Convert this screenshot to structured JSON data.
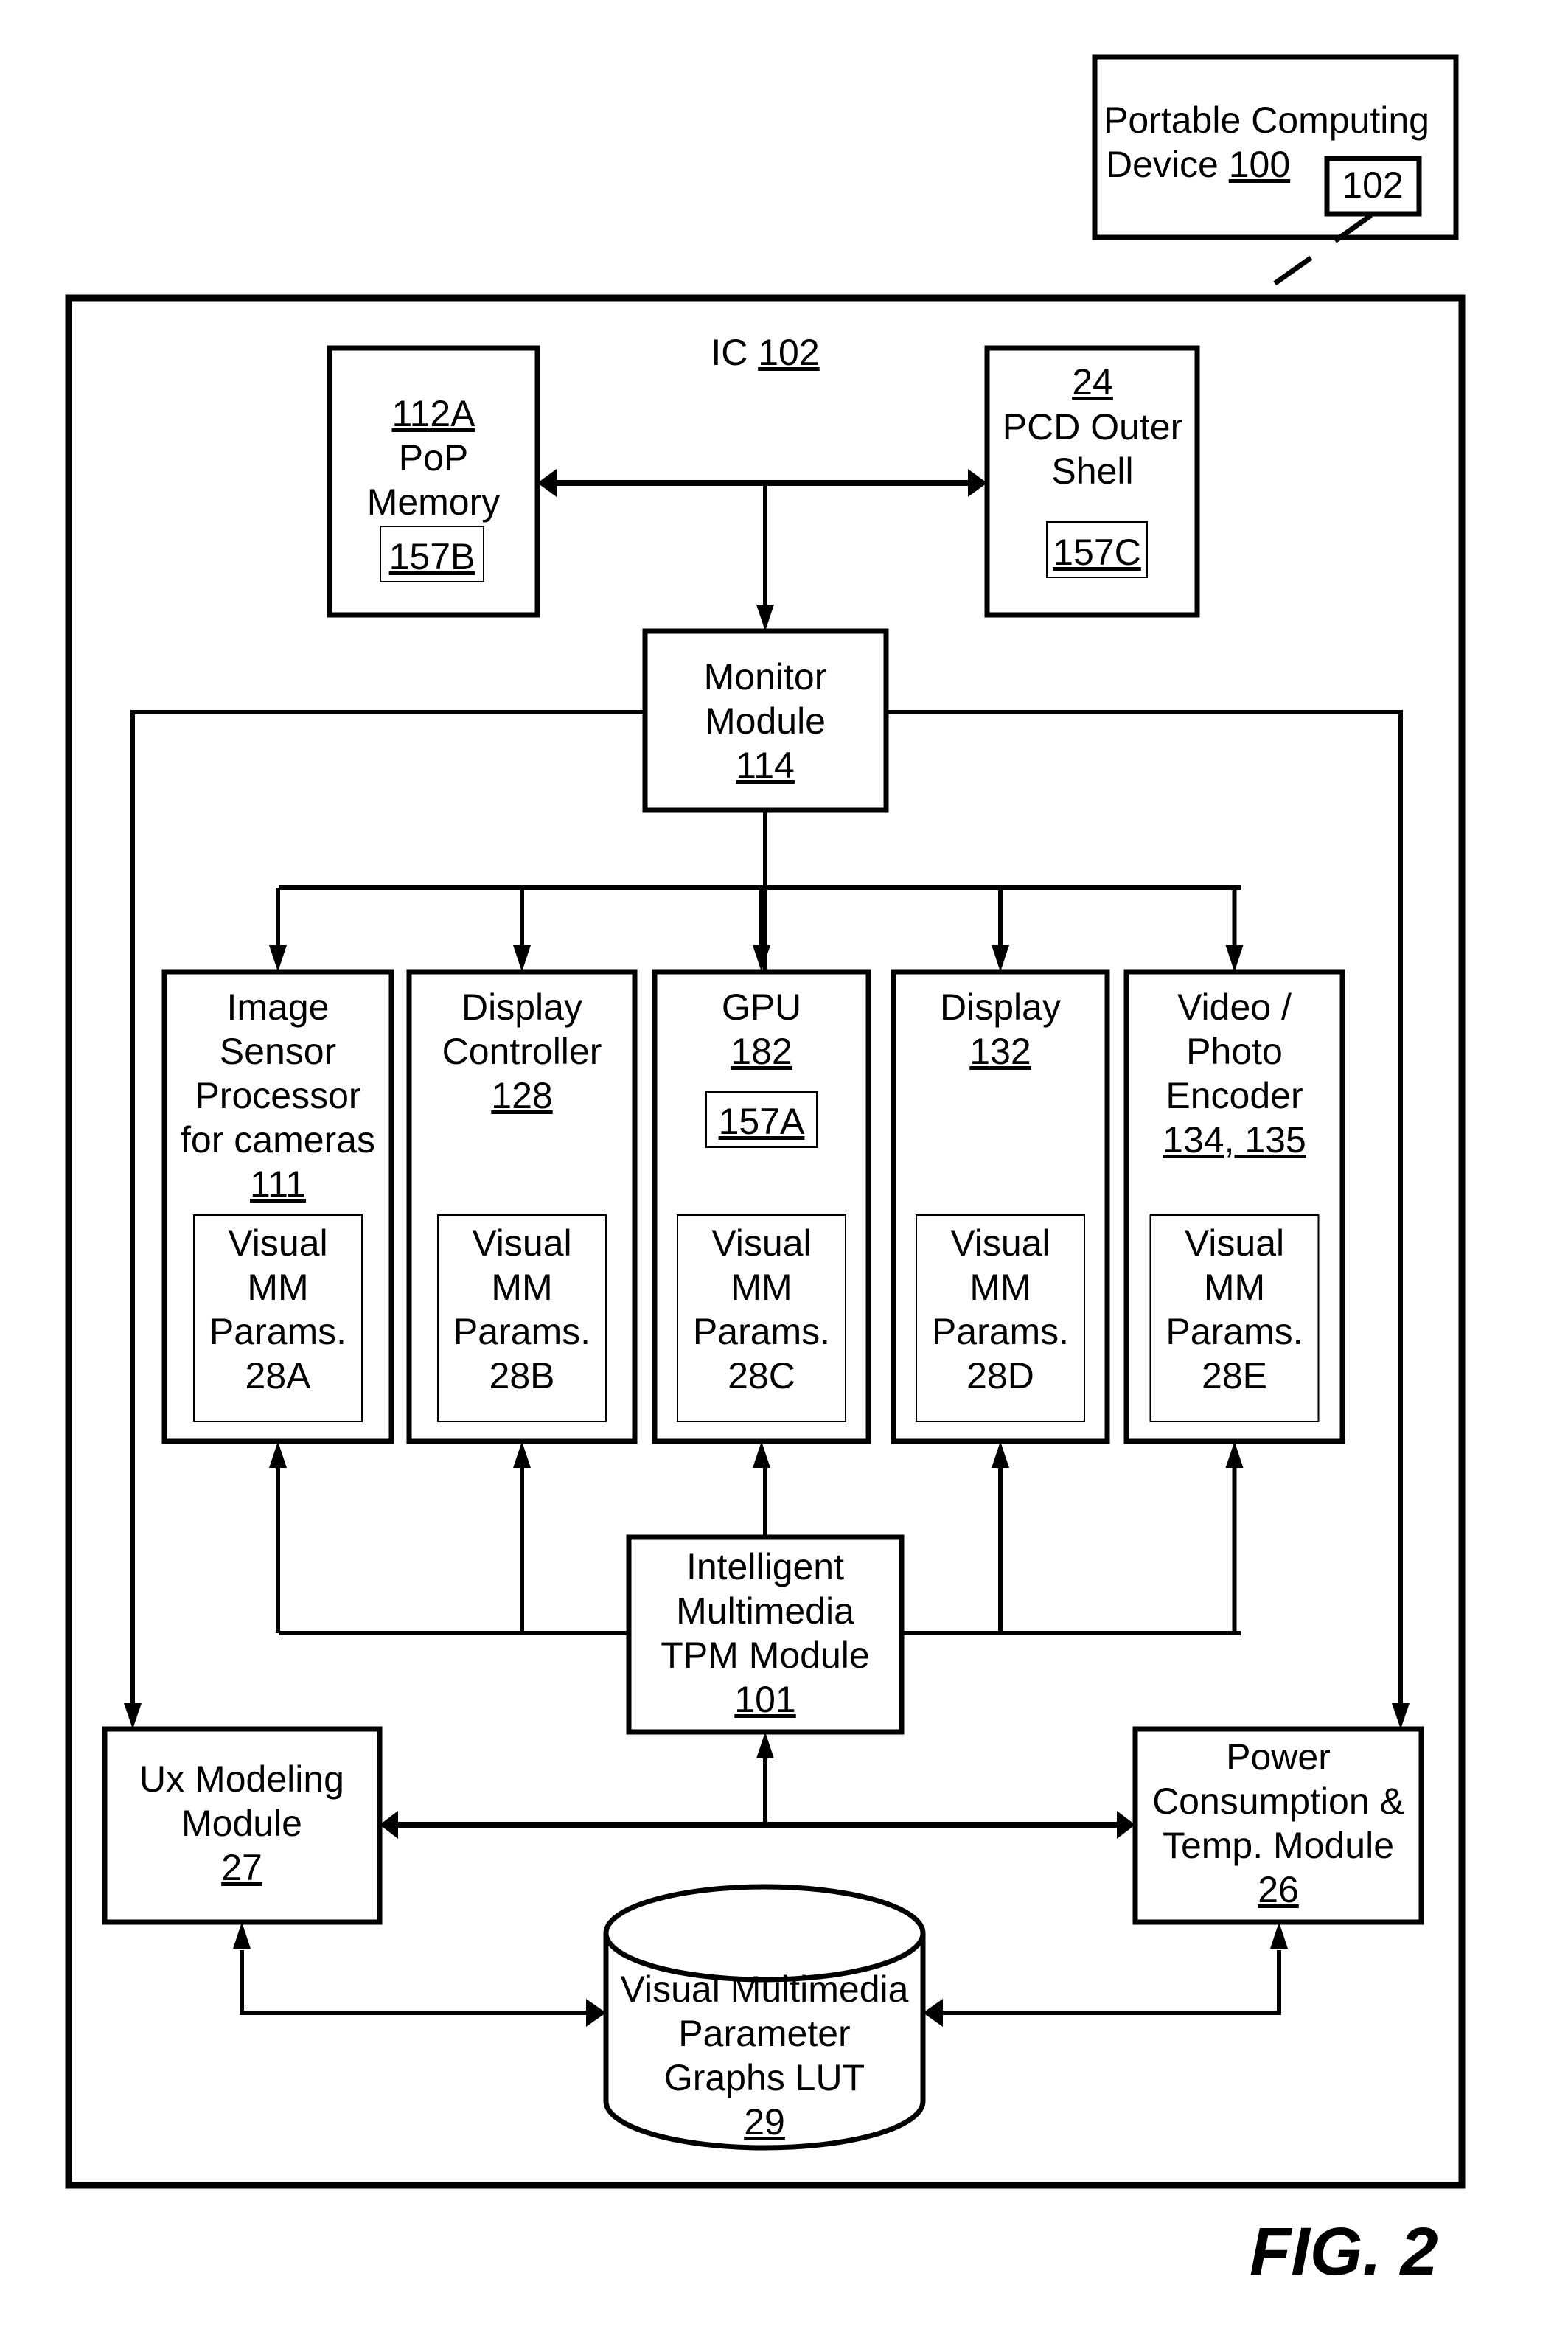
{
  "figure_label": "FIG. 2",
  "pcd": {
    "line1": "Portable Computing",
    "line2_prefix": "Device ",
    "ref": "100",
    "inner_ref": "102"
  },
  "ic": {
    "label_prefix": "IC ",
    "ref": "102"
  },
  "pop_memory": {
    "ref": "112A",
    "line1": "PoP",
    "line2": "Memory",
    "sensor_ref": "157B"
  },
  "outer_shell": {
    "ref": "24",
    "line1": "PCD Outer",
    "line2": "Shell",
    "sensor_ref": "157C"
  },
  "monitor": {
    "line1": "Monitor",
    "line2": "Module",
    "ref": "114"
  },
  "components": [
    {
      "lines": [
        "Image",
        "Sensor",
        "Processor",
        "for cameras"
      ],
      "ref": "111",
      "params": [
        "Visual",
        "MM",
        "Params.",
        "28A"
      ]
    },
    {
      "lines": [
        "Display",
        "Controller"
      ],
      "ref": "128",
      "params": [
        "Visual",
        "MM",
        "Params.",
        "28B"
      ]
    },
    {
      "lines": [
        "GPU"
      ],
      "ref": "182",
      "sensor_ref": "157A",
      "params": [
        "Visual",
        "MM",
        "Params.",
        "28C"
      ]
    },
    {
      "lines": [
        "Display"
      ],
      "ref": "132",
      "params": [
        "Visual",
        "MM",
        "Params.",
        "28D"
      ]
    },
    {
      "lines": [
        "Video /",
        "Photo",
        "Encoder"
      ],
      "ref": "134, 135",
      "params": [
        "Visual",
        "MM",
        "Params.",
        "28E"
      ]
    }
  ],
  "tpm": {
    "line1": "Intelligent",
    "line2": "Multimedia",
    "line3": "TPM Module",
    "ref": "101"
  },
  "ux": {
    "line1": "Ux Modeling",
    "line2": "Module",
    "ref": "27"
  },
  "power": {
    "line1": "Power",
    "line2": "Consumption &",
    "line3": "Temp. Module",
    "ref": "26"
  },
  "lut": {
    "line1": "Visual Multimedia",
    "line2": "Parameter",
    "line3": "Graphs LUT",
    "ref": "29"
  }
}
